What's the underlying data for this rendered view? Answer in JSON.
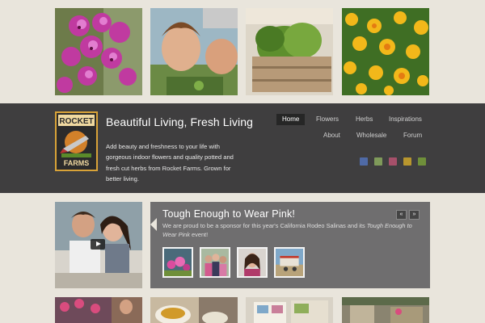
{
  "header": {
    "logo_text_top": "ROCKET",
    "logo_text_bottom": "FARMS",
    "site_title": "Beautiful Living, Fresh Living",
    "tagline": "Add beauty and freshness to your life with gorgeous indoor flowers and quality potted and fresh cut herbs from Rocket Farms. Grown for better living."
  },
  "nav": {
    "home": "Home",
    "flowers": "Flowers",
    "herbs": "Herbs",
    "inspirations": "Inspirations",
    "about": "About",
    "wholesale": "Wholesale",
    "forum": "Forum"
  },
  "social_icons": [
    "facebook-icon",
    "twitter-icon",
    "pinterest-icon",
    "youtube-icon",
    "blog-icon"
  ],
  "feature": {
    "title": "Tough Enough to Wear Pink!",
    "text_before": "We are proud to be a sponsor for this year's California Rodeo Salinas and its ",
    "text_em": "Tough Enough to Wear Pink",
    "text_after": " event!",
    "prev_label": "«",
    "next_label": "»"
  }
}
